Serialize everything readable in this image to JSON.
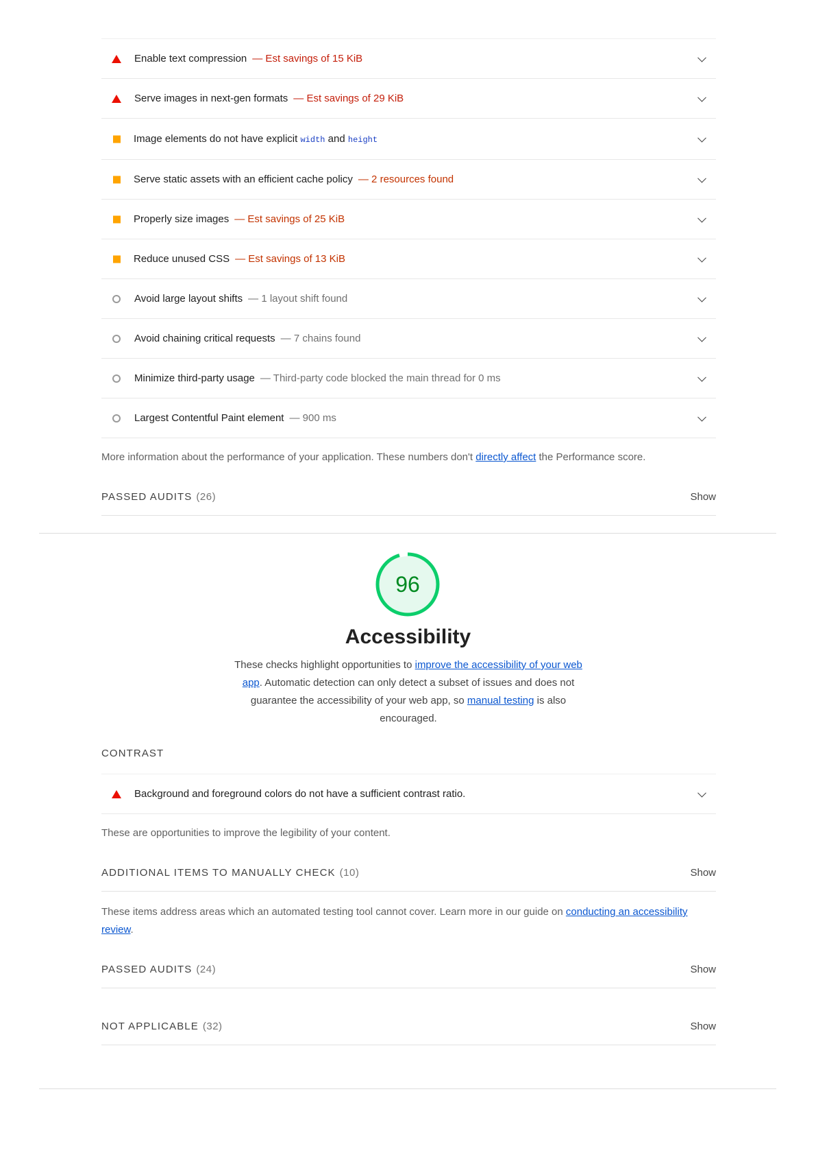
{
  "performance": {
    "audits": [
      {
        "icon": "fail-triangle-icon",
        "title": "Enable text compression",
        "display": "— Est savings of 15 KiB",
        "tone": "red"
      },
      {
        "icon": "fail-triangle-icon",
        "title": "Serve images in next-gen formats",
        "display": "— Est savings of 29 KiB",
        "tone": "red"
      },
      {
        "icon": "average-square-icon",
        "title_pre": "Image elements do not have explicit ",
        "code1": "width",
        "title_mid": " and ",
        "code2": "height",
        "display": "",
        "tone": "orange"
      },
      {
        "icon": "average-square-icon",
        "title": "Serve static assets with an efficient cache policy",
        "display": "— 2 resources found",
        "tone": "orange"
      },
      {
        "icon": "average-square-icon",
        "title": "Properly size images",
        "display": "— Est savings of 25 KiB",
        "tone": "orange"
      },
      {
        "icon": "average-square-icon",
        "title": "Reduce unused CSS",
        "display": "— Est savings of 13 KiB",
        "tone": "orange"
      },
      {
        "icon": "info-circle-icon",
        "title": "Avoid large layout shifts",
        "display": "— 1 layout shift found",
        "tone": "gray"
      },
      {
        "icon": "info-circle-icon",
        "title": "Avoid chaining critical requests",
        "display": "— 7 chains found",
        "tone": "gray"
      },
      {
        "icon": "info-circle-icon",
        "title": "Minimize third-party usage",
        "display": "— Third-party code blocked the main thread for 0 ms",
        "tone": "gray"
      },
      {
        "icon": "info-circle-icon",
        "title": "Largest Contentful Paint element",
        "display": "— 900 ms",
        "tone": "gray"
      }
    ],
    "note_pre": "More information about the performance of your application. These numbers don't ",
    "note_link": "directly affect",
    "note_post": " the Performance score.",
    "passed": {
      "label": "Passed audits",
      "count": "(26)",
      "action": "Show"
    }
  },
  "accessibility": {
    "score": "96",
    "score_color": "#0cce6b",
    "title": "Accessibility",
    "desc_1": "These checks highlight opportunities to ",
    "desc_link_1": "improve the accessibility of your web app",
    "desc_2": ". Automatic detection can only detect a subset of issues and does not guarantee the accessibility of your web app, so ",
    "desc_link_2": "manual testing",
    "desc_3": " is also encouraged.",
    "contrast_label": "Contrast",
    "contrast_audit": "Background and foreground colors do not have a sufficient contrast ratio.",
    "contrast_note": "These are opportunities to improve the legibility of your content.",
    "manual": {
      "label": "Additional items to manually check",
      "count": "(10)",
      "action": "Show"
    },
    "manual_note_pre": "These items address areas which an automated testing tool cannot cover. Learn more in our guide on ",
    "manual_note_link": "conducting an accessibility review",
    "manual_note_post": ".",
    "passed": {
      "label": "Passed audits",
      "count": "(24)",
      "action": "Show"
    },
    "not_applicable": {
      "label": "Not applicable",
      "count": "(32)",
      "action": "Show"
    }
  }
}
